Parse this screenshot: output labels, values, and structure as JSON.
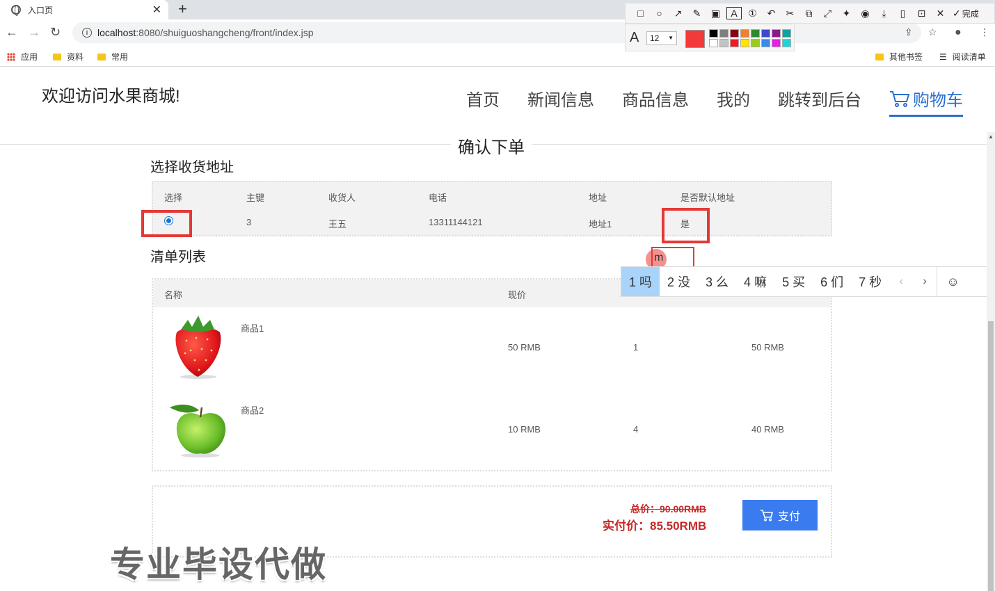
{
  "browser": {
    "tab_title": "入口页",
    "url_host": "localhost",
    "url_rest": ":8080/shuiguoshangcheng/front/index.jsp",
    "bookmarks": [
      "应用",
      "资料",
      "常用"
    ],
    "bookmarks_right": [
      "其他书签",
      "阅读清单"
    ]
  },
  "annotation": {
    "done_label": "完成",
    "font_size": "12",
    "current_color": "#f23a3a",
    "palette": [
      "#000000",
      "#7f7f7f",
      "#880015",
      "#f07f30",
      "#2f8a2f",
      "#3f48cc",
      "#8b1a8b",
      "#12a0a0",
      "#ffffff",
      "#c3c3c3",
      "#ed1c24",
      "#ffe600",
      "#9ccb1d",
      "#3a8be8",
      "#e61ee6",
      "#22d3d3"
    ]
  },
  "site": {
    "title": "欢迎访问水果商城!",
    "nav": [
      "首页",
      "新闻信息",
      "商品信息",
      "我的",
      "跳转到后台",
      "购物车"
    ],
    "accent": "#2a6fcf"
  },
  "page": {
    "section_title": "确认下单",
    "address_title": "选择收货地址",
    "list_title": "清单列表"
  },
  "address_table": {
    "headers": [
      "选择",
      "主键",
      "收货人",
      "电话",
      "地址",
      "是否默认地址"
    ],
    "rows": [
      {
        "id": "3",
        "name": "王五",
        "phone": "13311144121",
        "address": "地址1",
        "default": "是"
      }
    ]
  },
  "order_table": {
    "headers": [
      "名称",
      "现价"
    ],
    "rows": [
      {
        "name": "商品1",
        "price": "50 RMB",
        "qty": "1",
        "subtotal": "50 RMB",
        "image": "strawberry"
      },
      {
        "name": "商品2",
        "price": "10 RMB",
        "qty": "4",
        "subtotal": "40 RMB",
        "image": "green-apple"
      }
    ]
  },
  "summary": {
    "total_label": "总价：90.00RMB",
    "paid_label": "实付价：85.50RMB",
    "pay_button": "支付"
  },
  "ime": {
    "pinyin": "m",
    "candidates": [
      "1 吗",
      "2 没",
      "3 么",
      "4 嘛",
      "5 买",
      "6 们",
      "7 秒"
    ]
  },
  "watermark": "专业毕设代做"
}
